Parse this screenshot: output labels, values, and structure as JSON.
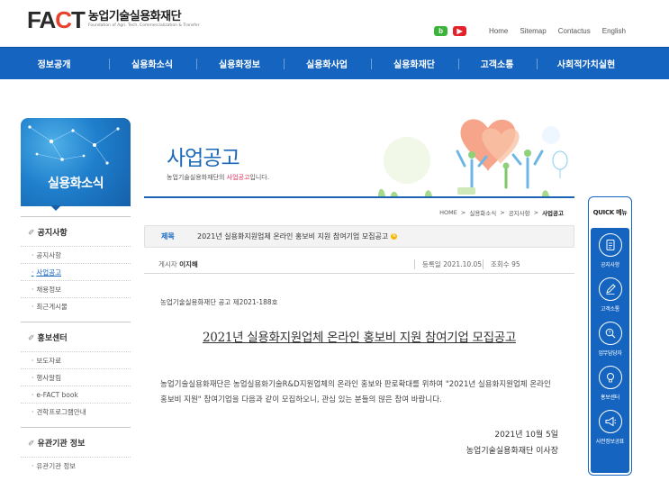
{
  "header": {
    "logo_mark": "FACT",
    "logo_name": "농업기술실용화재단",
    "logo_sub": "Foundation of Agri. Tech. Commercialization & Transfer",
    "sns": {
      "blog": "b",
      "youtube": "▶"
    },
    "util_links": [
      "Home",
      "Sitemap",
      "Contactus",
      "English"
    ]
  },
  "gnb": [
    "정보공개",
    "실용화소식",
    "실용화정보",
    "실용화사업",
    "실용화재단",
    "고객소통",
    "사회적가치실현"
  ],
  "sidebar": {
    "title": "실용화소식",
    "sections": [
      {
        "title": "공지사항",
        "items": [
          "공지사항",
          "사업공고",
          "채용정보",
          "최근게시물"
        ]
      },
      {
        "title": "홍보센터",
        "items": [
          "보도자료",
          "행사알림",
          "e-FACT book",
          "견학프로그램안내"
        ]
      },
      {
        "title": "유관기관 정보",
        "items": [
          "유관기관 정보"
        ]
      }
    ],
    "active_item": "사업공고"
  },
  "content": {
    "title": "사업공고",
    "desc_before": "농업기술실용화재단의 ",
    "desc_highlight": "사업공고",
    "desc_after": "입니다.",
    "breadcrumb": [
      "HOME",
      "실용화소식",
      "공지사항",
      "사업공고"
    ]
  },
  "post": {
    "subject_label": "제목",
    "subject": "2021년 실용화지원업체 온라인 홍보비 지원 참여기업 모집공고",
    "new_badge": "N",
    "writer_label": "게시자",
    "writer": "이지해",
    "date_label": "등록일",
    "date": "2021.10.05.",
    "views_label": "조회수",
    "views": "95",
    "doc_no": "농업기술실용화재단 공고 제2021-188호",
    "doc_title": "2021년 실용화지원업체 온라인 홍보비 지원 참여기업 모집공고",
    "doc_text": "농업기술실용화재단은 농업실용화기술R&D지원업체의 온라인 홍보와 판로확대를 위하여 \"2021년 실용화지원업체 온라인 홍보비 지원\" 참여기업을 다음과 같이 모집하오니, 관심 있는 분들의 많은 참여 바랍니다.",
    "doc_date": "2021년 10월 5일",
    "doc_org": "농업기술실용화재단 이사장"
  },
  "quick_menu": {
    "title": "QUICK 메뉴",
    "items": [
      {
        "label": "공지사항",
        "icon": "document-icon"
      },
      {
        "label": "고객소통",
        "icon": "pencil-icon"
      },
      {
        "label": "업무담당자",
        "icon": "person-search-icon"
      },
      {
        "label": "홍보센터",
        "icon": "lightbulb-icon"
      },
      {
        "label": "사전정보공표",
        "icon": "megaphone-icon"
      }
    ]
  },
  "colors": {
    "brand_blue": "#1565c0",
    "accent_red": "#e8412c",
    "highlight_pink": "#e0305a"
  }
}
